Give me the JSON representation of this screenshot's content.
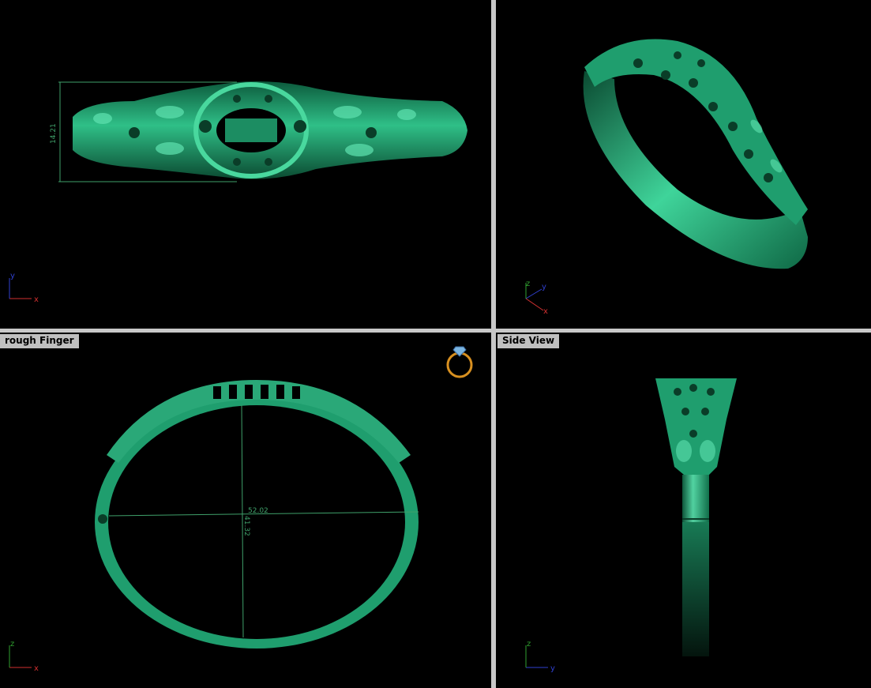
{
  "viewports": {
    "top": {
      "label": "",
      "dimension": "14.21",
      "axes": [
        "y",
        "x"
      ]
    },
    "perspective": {
      "label": "",
      "axes": [
        "z",
        "y",
        "x"
      ]
    },
    "through_finger": {
      "label": "rough Finger",
      "dimensions": [
        "52.02",
        "41.32"
      ],
      "axes": [
        "z",
        "x"
      ]
    },
    "side": {
      "label": "Side View",
      "axes": [
        "z",
        "y"
      ]
    }
  },
  "colors": {
    "model": "#1f9e6e",
    "model_highlight": "#5fe3b0",
    "model_dark": "#0a4a32",
    "axis_x": "#d03030",
    "axis_y": "#3040d0",
    "axis_z": "#30a030",
    "divider": "#c8c8c8",
    "label_bg": "#c0c0c0"
  }
}
